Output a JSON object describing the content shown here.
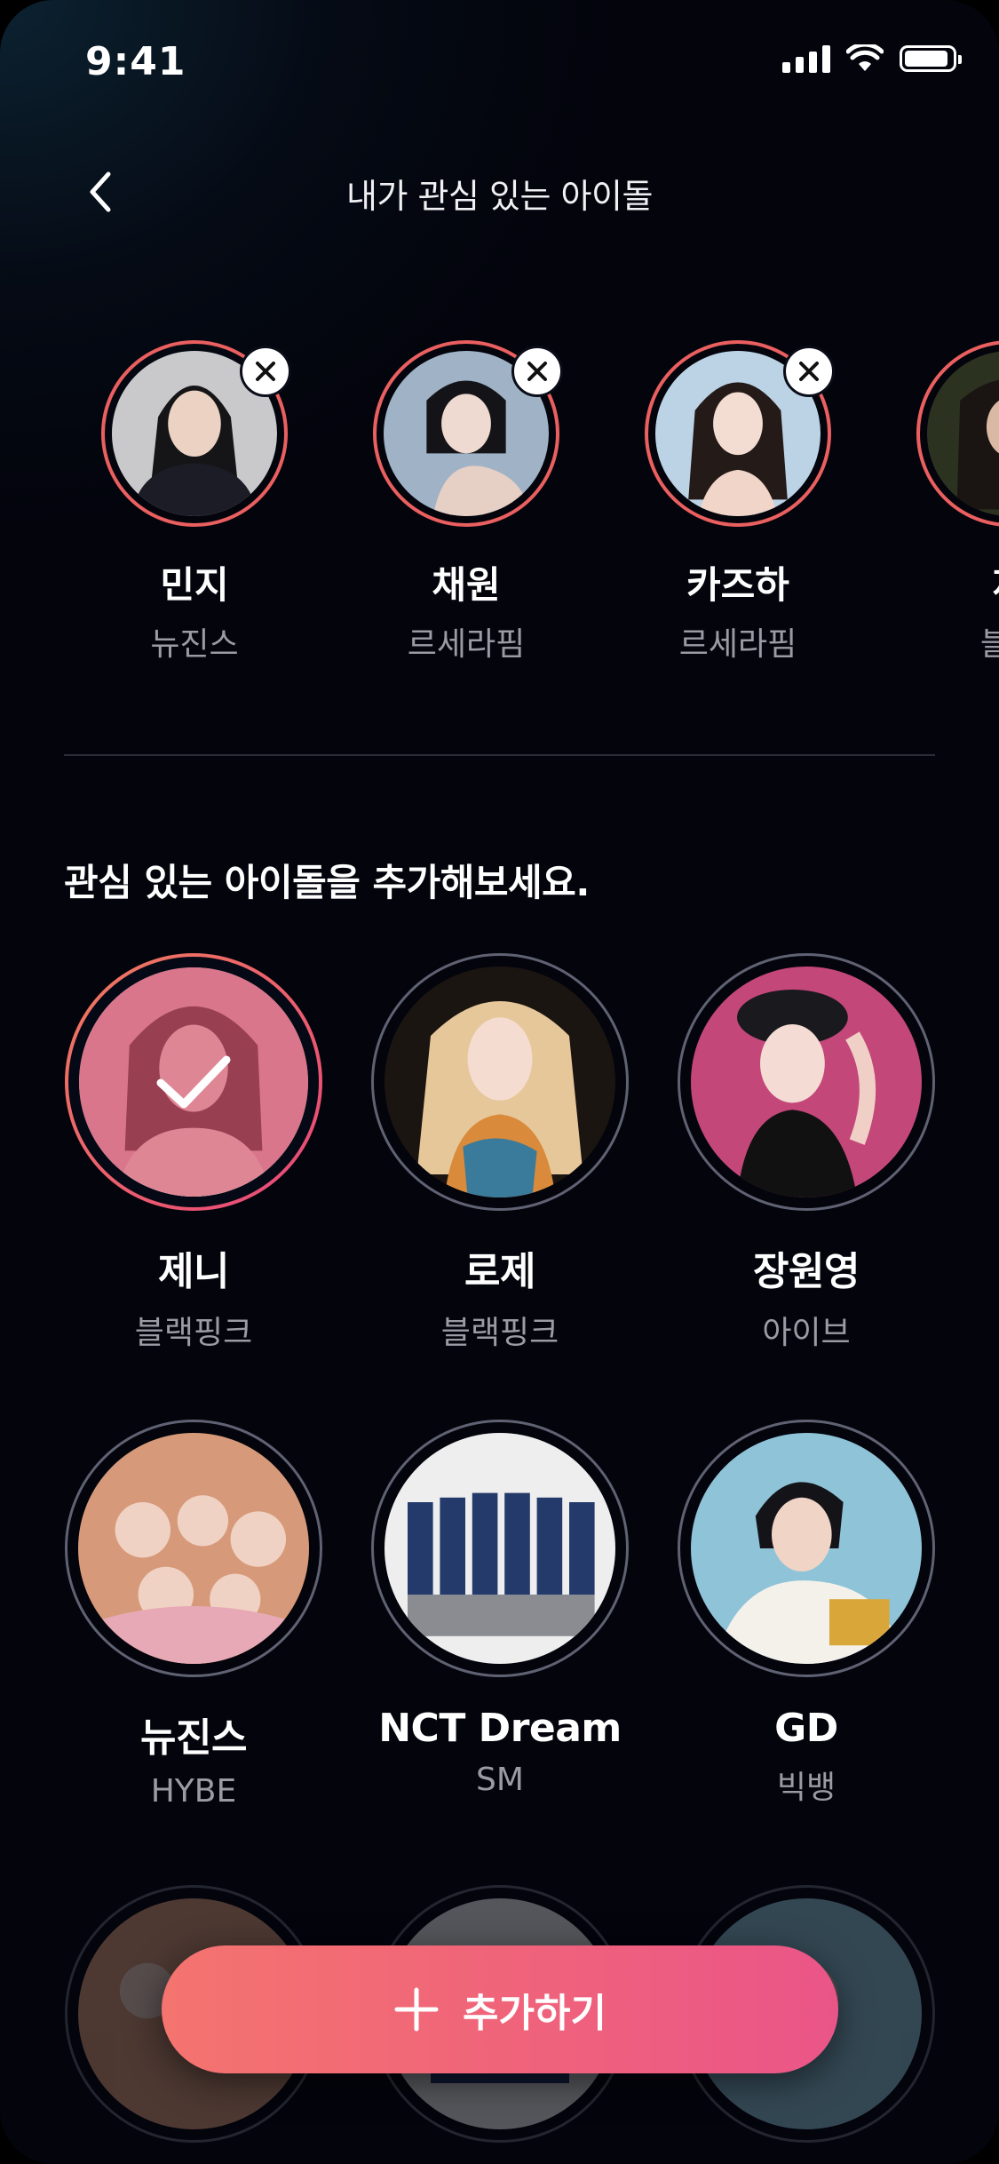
{
  "status_bar": {
    "time": "9:41"
  },
  "header": {
    "title": "내가 관심 있는 아이돌",
    "back_icon": "chevron-left-icon"
  },
  "favorites": [
    {
      "name": "민지",
      "group": "뉴진스"
    },
    {
      "name": "채원",
      "group": "르세라핌"
    },
    {
      "name": "카즈하",
      "group": "르세라핌"
    },
    {
      "name": "제",
      "group": "블랙"
    }
  ],
  "add_section": {
    "title": "관심 있는 아이돌을 추가해보세요."
  },
  "idols": [
    {
      "name": "제니",
      "group": "블랙핑크",
      "selected": true
    },
    {
      "name": "로제",
      "group": "블랙핑크",
      "selected": false
    },
    {
      "name": "장원영",
      "group": "아이브",
      "selected": false
    },
    {
      "name": "뉴진스",
      "group": "HYBE",
      "selected": false
    },
    {
      "name": "NCT Dream",
      "group": "SM",
      "selected": false
    },
    {
      "name": "GD",
      "group": "빅뱅",
      "selected": false
    }
  ],
  "add_button": {
    "label": "추가하기",
    "icon": "plus-icon"
  },
  "colors": {
    "accent": "#EA5F5F",
    "button_gradient_start": "#F4746F",
    "button_gradient_end": "#EA5588"
  }
}
